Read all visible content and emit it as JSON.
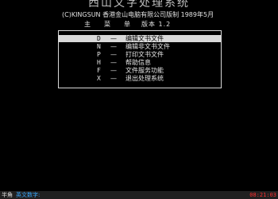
{
  "title": "西山文字处理系统",
  "copyright": "(C)KINGSUN 香港金山电脑有限公司版制 1989年5月",
  "menu": {
    "header_main": "主",
    "header_menu1": "菜",
    "header_menu2": "单",
    "header_version": "版本 1.2",
    "items": [
      {
        "key": "D",
        "dash": "—",
        "label": "编辑文书文件"
      },
      {
        "key": "N",
        "dash": "—",
        "label": "编辑非文书文件"
      },
      {
        "key": "P",
        "dash": "—",
        "label": "打印文书文件"
      },
      {
        "key": "H",
        "dash": "—",
        "label": "帮助信息"
      },
      {
        "key": "F",
        "dash": "—",
        "label": "文件服务功能"
      },
      {
        "key": "X",
        "dash": "—",
        "label": "退出处理系统"
      }
    ]
  },
  "status": {
    "mode": "半角",
    "input_label": "英文数字:",
    "time": "08:21:03"
  }
}
